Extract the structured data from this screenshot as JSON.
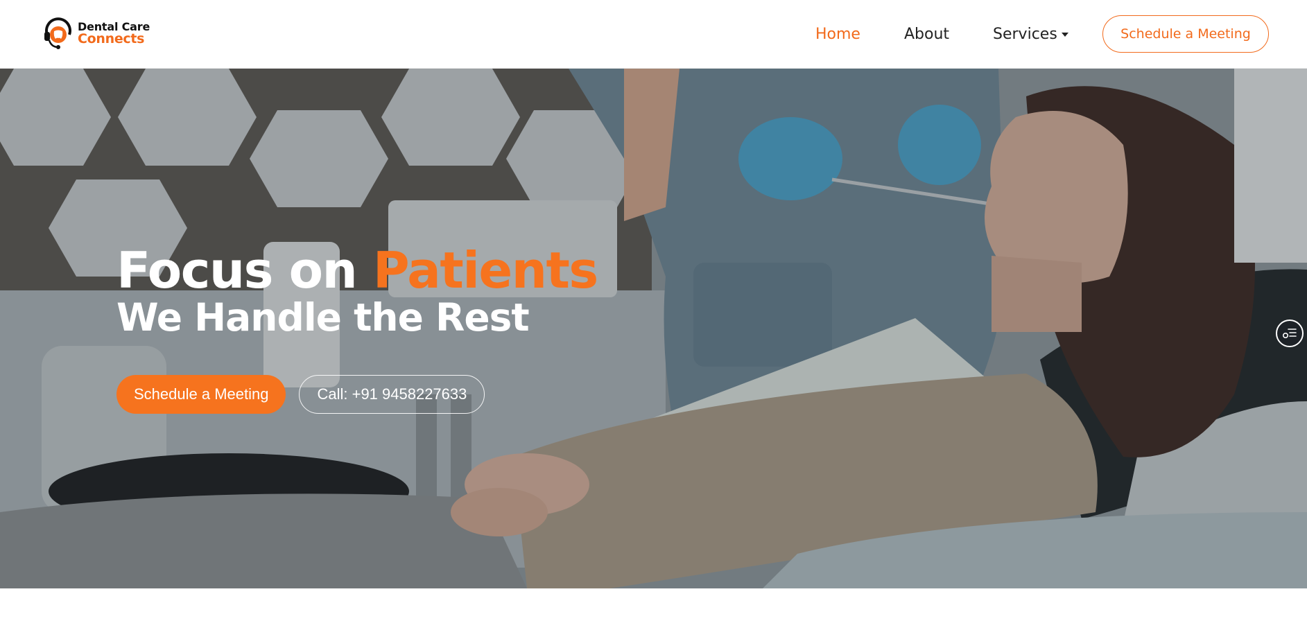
{
  "brand": {
    "line1": "Dental Care",
    "line2": "Connects",
    "accent_color": "#f26a1b",
    "icon": "tooth-headset-logo-icon"
  },
  "nav": {
    "items": [
      {
        "label": "Home",
        "active": true
      },
      {
        "label": "About",
        "active": false
      },
      {
        "label": "Services",
        "active": false,
        "has_dropdown": true
      }
    ],
    "cta_label": "Schedule a Meeting"
  },
  "hero": {
    "title_part1": "Focus on",
    "title_part2": "Patients",
    "subtitle": "We Handle the Rest",
    "primary_button": "Schedule a Meeting",
    "secondary_button": "Call: +91 9458227633",
    "background": "dentist-examining-patient-photo"
  },
  "widget": {
    "icon": "accessibility-menu-icon"
  }
}
